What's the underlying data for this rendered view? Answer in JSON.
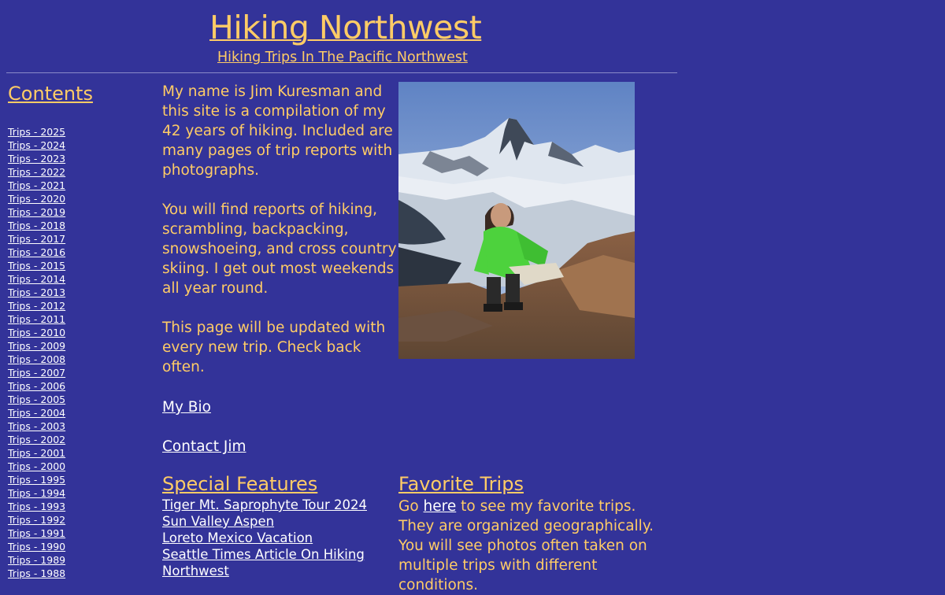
{
  "header": {
    "title": "Hiking Northwest",
    "subtitle": "Hiking Trips In The Pacific Northwest"
  },
  "sidebar": {
    "heading": "Contents",
    "trips": [
      "Trips - 2025",
      "Trips - 2024",
      "Trips - 2023",
      "Trips - 2022",
      "Trips - 2021",
      "Trips - 2020",
      "Trips - 2019",
      "Trips - 2018",
      "Trips - 2017",
      "Trips - 2016",
      "Trips - 2015",
      "Trips - 2014",
      "Trips - 2013",
      "Trips - 2012",
      "Trips - 2011",
      "Trips - 2010",
      "Trips - 2009",
      "Trips - 2008",
      "Trips - 2007",
      "Trips - 2006",
      "Trips - 2005",
      "Trips - 2004",
      "Trips - 2003",
      "Trips - 2002",
      "Trips - 2001",
      "Trips - 2000",
      "Trips - 1995",
      "Trips - 1994",
      "Trips - 1993",
      "Trips - 1992",
      "Trips - 1991",
      "Trips - 1990",
      "Trips - 1989",
      "Trips - 1988"
    ]
  },
  "intro": {
    "paragraphs": [
      "My name is Jim Kuresman and this  site is a compilation of my 42 years of hiking. Included are many pages of trip reports with photographs.",
      "You will find reports of hiking, scrambling, backpacking, snowshoeing, and cross country skiing. I get out most weekends all year round.",
      "This page will be updated with every new trip. Check back often."
    ],
    "bio_link": "My Bio",
    "contact_link": "Contact Jim"
  },
  "special_features": {
    "heading": "Special Features",
    "items": [
      "Tiger Mt. Saprophyte Tour 2024",
      "Sun Valley Aspen",
      "Loreto Mexico Vacation",
      "Seattle Times Article On Hiking Northwest "
    ]
  },
  "favorite_trips": {
    "heading": "Favorite Trips",
    "text_before": "Go ",
    "link": "here",
    "text_after": " to see my favorite trips. They are organized geographically. You will see photos often taken on multiple trips with different conditions."
  },
  "colors": {
    "background": "#333399",
    "accent_text": "#ffcc66",
    "link": "#ffffff"
  }
}
